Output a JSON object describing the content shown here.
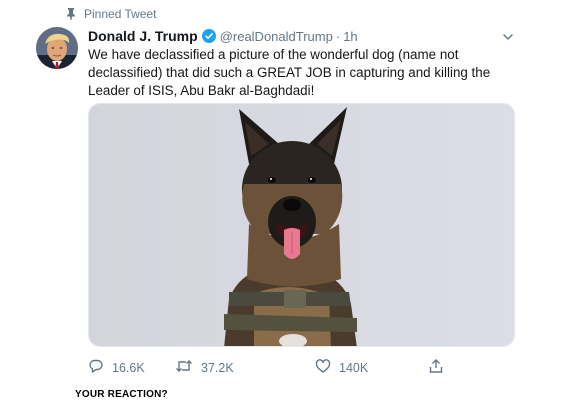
{
  "pinned": {
    "label": "Pinned Tweet",
    "icon": "pin-icon"
  },
  "author": {
    "display_name": "Donald J. Trump",
    "handle": "@realDonaldTrump",
    "separator": "·",
    "time": "1h",
    "verified": true,
    "verified_color": "#1da1f2"
  },
  "tweet": {
    "text_lines": [
      "We have declassified a picture of the wonderful dog (name not",
      "declassified) that did such a GREAT JOB in capturing and killing the",
      "Leader of ISIS, Abu Bakr al-Baghdadi!"
    ]
  },
  "actions": {
    "reply": {
      "count": "16.6K",
      "icon": "reply-icon"
    },
    "retweet": {
      "count": "37.2K",
      "icon": "retweet-icon"
    },
    "like": {
      "count": "140K",
      "icon": "heart-icon"
    },
    "share": {
      "icon": "share-icon"
    }
  },
  "caption": "YOUR REACTION?",
  "colors": {
    "icon_gray": "#657786",
    "text": "#14171a",
    "accent": "#1da1f2",
    "border": "#e1e8ed"
  }
}
